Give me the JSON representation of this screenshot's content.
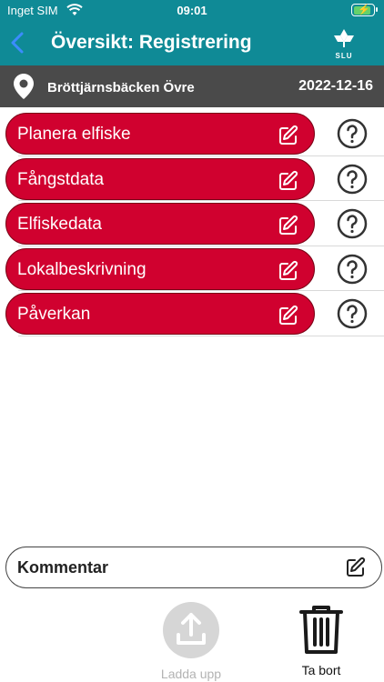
{
  "status_bar": {
    "carrier": "Inget SIM",
    "time": "09:01"
  },
  "header": {
    "title": "Översikt: Registrering",
    "logo_text": "SLU"
  },
  "location": {
    "name": "Bröttjärnsbäcken Övre",
    "date": "2022-12-16"
  },
  "sections": [
    {
      "label": "Planera elfiske"
    },
    {
      "label": "Fångstdata"
    },
    {
      "label": "Elfiskedata"
    },
    {
      "label": "Lokalbeskrivning"
    },
    {
      "label": "Påverkan"
    }
  ],
  "comment": {
    "label": "Kommentar"
  },
  "actions": {
    "upload_label": "Ladda upp",
    "delete_label": "Ta bort"
  },
  "colors": {
    "header": "#0f8a96",
    "location_bar": "#4a4a4a",
    "section": "#d0012f",
    "battery": "#65d16b"
  },
  "icons": [
    "wifi-icon",
    "battery-icon",
    "back-chevron-icon",
    "slu-logo",
    "location-pin-icon",
    "edit-icon",
    "help-icon",
    "upload-icon",
    "trash-icon"
  ]
}
